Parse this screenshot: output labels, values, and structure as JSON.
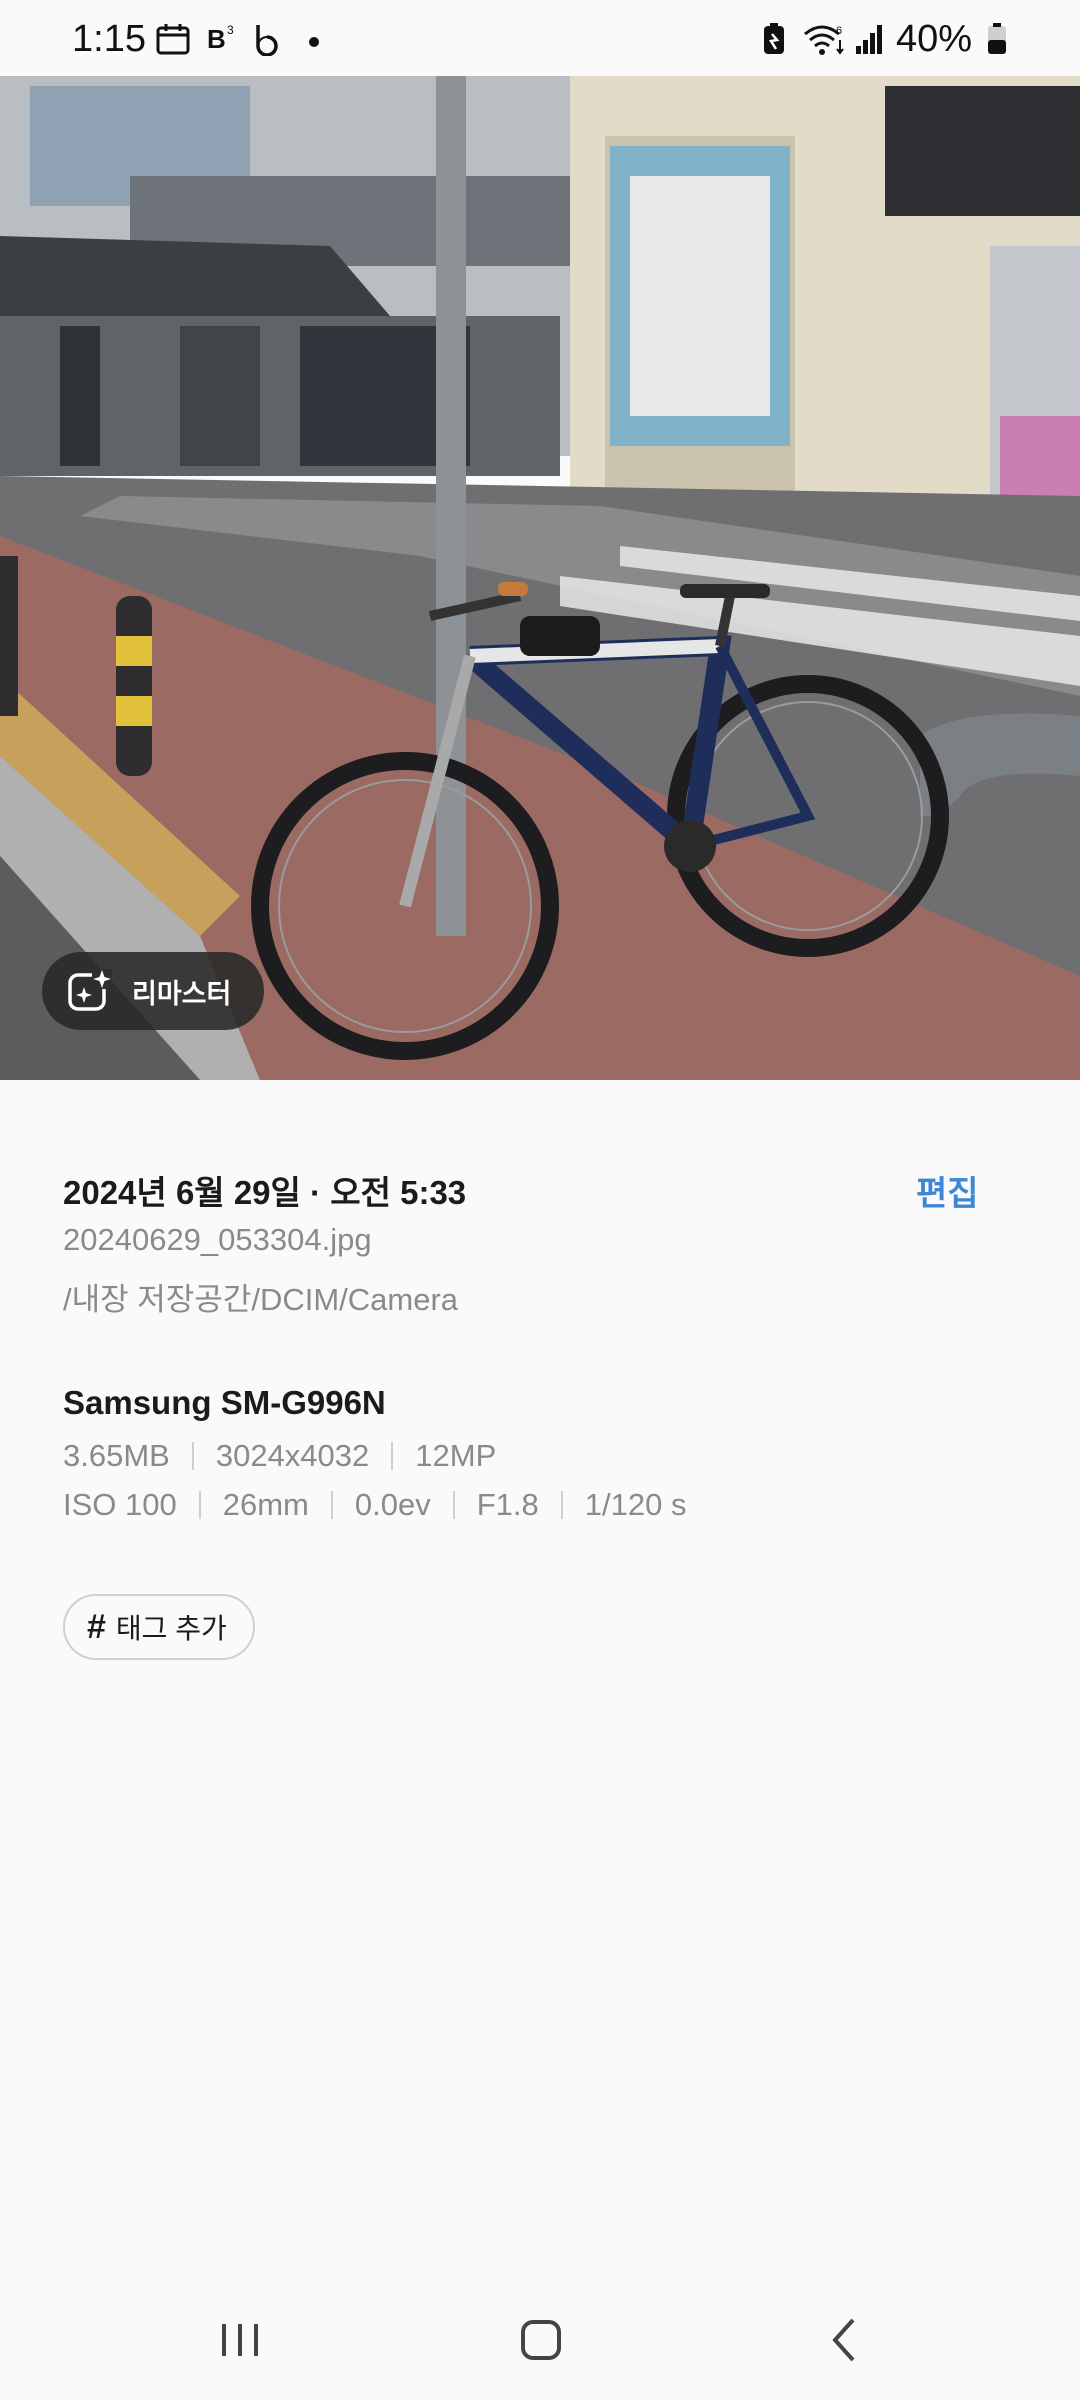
{
  "status_bar": {
    "time": "1:15",
    "battery_percent": "40%",
    "icons": [
      "calendar-icon",
      "b-app-icon",
      "b-logo-icon",
      "dot-icon",
      "battery-saver-icon",
      "wifi-icon",
      "signal-icon",
      "battery-icon"
    ]
  },
  "photo": {
    "remaster_label": "리마스터"
  },
  "details": {
    "date": "2024년 6월 29일 · 오전 5:33",
    "edit_label": "편집",
    "filename": "20240629_053304.jpg",
    "path": "/내장 저장공간/DCIM/Camera",
    "device": "Samsung SM-G996N",
    "file_specs": [
      "3.65MB",
      "3024x4032",
      "12MP"
    ],
    "camera_specs": [
      "ISO 100",
      "26mm",
      "0.0ev",
      "F1.8",
      "1/120 s"
    ],
    "tag_button_label": "태그 추가"
  },
  "colors": {
    "accent": "#3e86d6",
    "background": "#fafafa",
    "primary_text": "#1b1b1b",
    "secondary_text": "#8a8a8a"
  }
}
